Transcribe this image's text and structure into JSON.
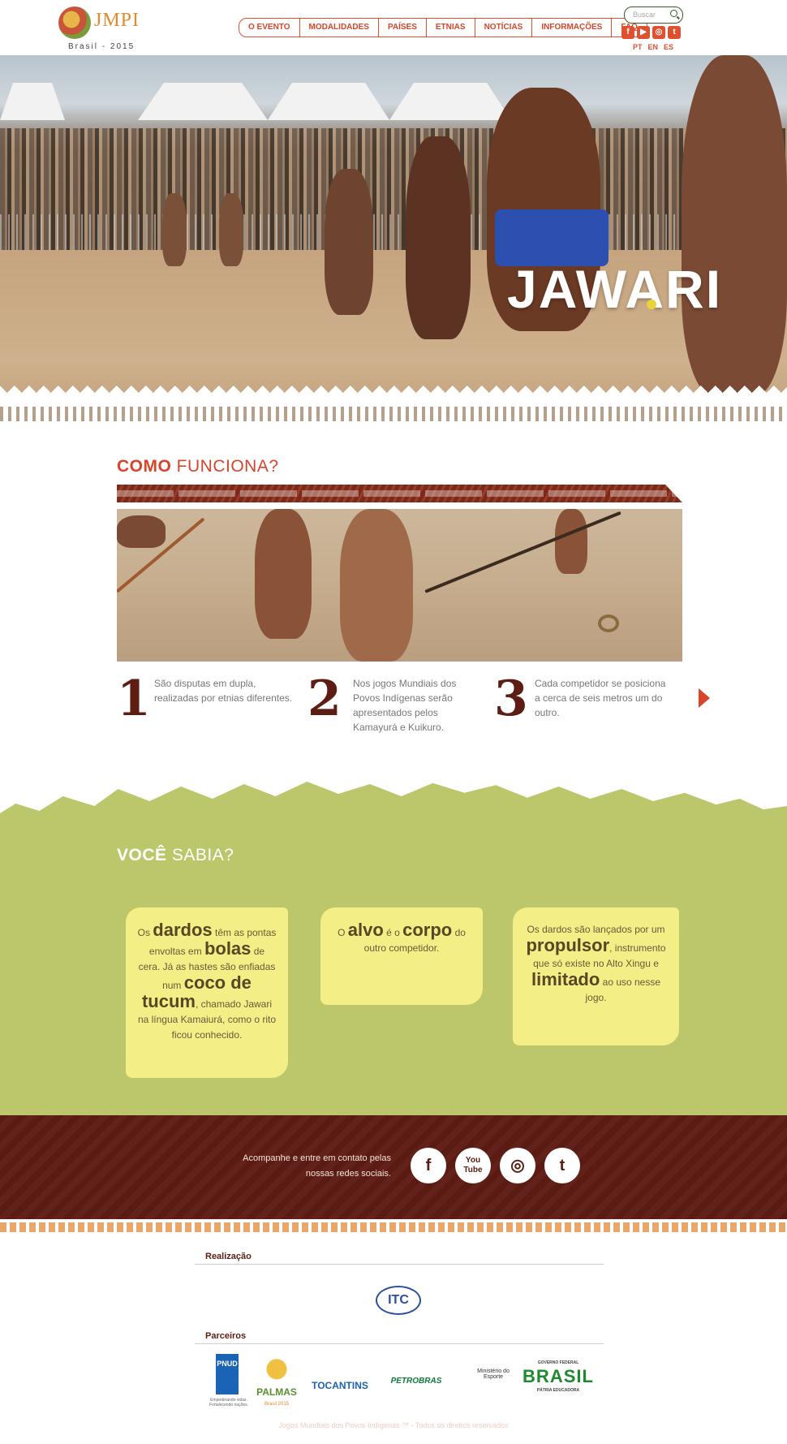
{
  "header": {
    "logo_text": "JMPI",
    "logo_sub": "Brasil - 2015",
    "nav": [
      "O EVENTO",
      "MODALIDADES",
      "PAÍSES",
      "ETNIAS",
      "NOTÍCIAS",
      "INFORMAÇÕES",
      "FAQ"
    ],
    "search_placeholder": "Buscar",
    "social": [
      "f",
      "▶",
      "◎",
      "t"
    ],
    "languages": [
      "PT",
      "EN",
      "ES"
    ]
  },
  "hero": {
    "title": "JAWARI"
  },
  "como": {
    "title_strong": "COMO",
    "title_rest": " FUNCIONA?",
    "steps": [
      {
        "num": "1",
        "text": "São disputas em dupla, realizadas por etnias diferentes."
      },
      {
        "num": "2",
        "text": "Nos jogos Mundiais dos Povos Indígenas serão apresentados pelos Kamayurá e Kuikuro."
      },
      {
        "num": "3",
        "text": "Cada competidor se posiciona a cerca de seis metros um do outro."
      }
    ]
  },
  "voce": {
    "title_strong": "VOCÊ",
    "title_rest": " SABIA?",
    "cards": {
      "c1": {
        "a": "Os ",
        "b1": "dardos",
        "c": " têm as pontas envoltas em ",
        "b2": "bolas",
        "d": " de cera. Já as hastes são enfiadas num ",
        "b3": "coco de tucum",
        "e": ", chamado Jawari na língua Kamaiurá, como o rito ficou conhecido."
      },
      "c2": {
        "a": "O ",
        "b1": "alvo",
        "c": " é o ",
        "b2": "corpo",
        "d": " do outro competidor."
      },
      "c3": {
        "a": "Os dardos são lançados por um ",
        "b1": "propulsor",
        "c": ", instrumento que só existe no Alto Xingu e ",
        "b2": "limitado",
        "d": " ao uso nesse jogo."
      }
    }
  },
  "footer": {
    "contact_text": "Acompanhe e entre em contato pelas nossas redes sociais.",
    "icons": [
      "f",
      "You Tube",
      "◎",
      "t"
    ],
    "realizacao_label": "Realização",
    "realizacao_logo": "ITC",
    "parceiros_label": "Parceiros",
    "partners": [
      "PNUD",
      "PALMAS",
      "TOCANTINS",
      "PETROBRAS",
      "Ministério do Esporte",
      "BRASIL"
    ],
    "pnud_caption": "Empoderando vidas. Fortalecendo nações.",
    "palmas_caption": "Brasil 2015",
    "brasil_top": "GOVERNO FEDERAL",
    "brasil_caption": "PÁTRIA EDUCADORA",
    "copyright": "Jogos Mundiais dos Povos Indígenas ™ - Todos os direitos reservados"
  },
  "colors": {
    "accent": "#d9452a",
    "brown": "#5a1c12",
    "green": "#bcc66b",
    "card_yellow": "#f3ee86"
  }
}
